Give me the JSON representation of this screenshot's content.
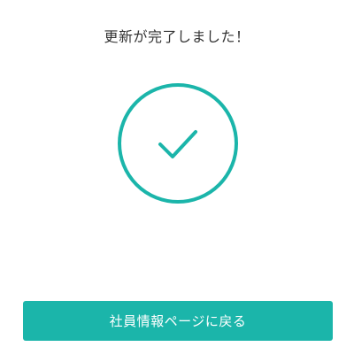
{
  "message": {
    "title": "更新が完了しました！"
  },
  "icon": {
    "name": "checkmark-circle-icon",
    "color": "#1bb5aa"
  },
  "button": {
    "label": "社員情報ページに戻る",
    "background_color": "#1bb5aa",
    "text_color": "#ffffff"
  }
}
